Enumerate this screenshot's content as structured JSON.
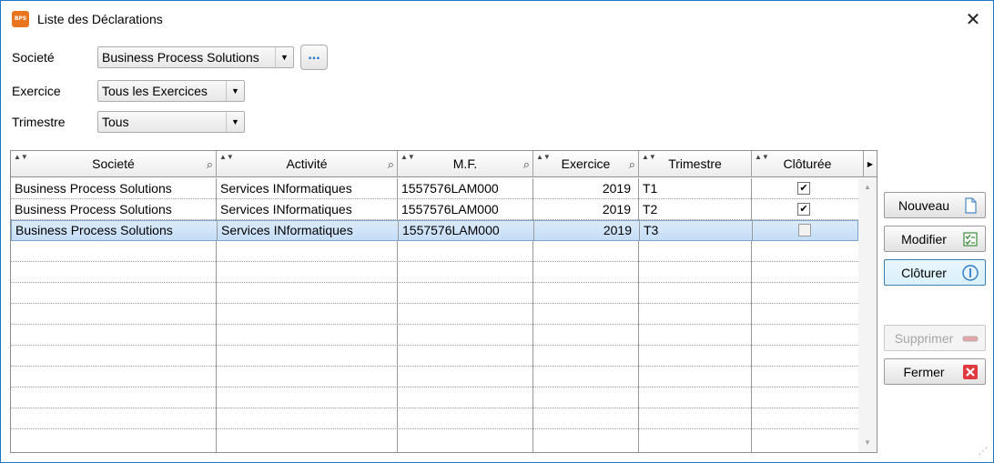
{
  "window": {
    "icon_label": "BPS",
    "title": "Liste des Déclarations",
    "close_glyph": "✕"
  },
  "filters": {
    "societe_label": "Societé",
    "societe_value": "Business Process Solutions",
    "ellipsis_label": "...",
    "exercice_label": "Exercice",
    "exercice_value": "Tous les Exercices",
    "trimestre_label": "Trimestre",
    "trimestre_value": "Tous"
  },
  "grid": {
    "columns": [
      "Societé",
      "Activité",
      "M.F.",
      "Exercice",
      "Trimestre",
      "Clôturée"
    ],
    "rows": [
      {
        "societe": "Business Process Solutions",
        "activite": "Services INformatiques",
        "mf": "1557576LAM000",
        "exercice": "2019",
        "trimestre": "T1",
        "cloturee": true
      },
      {
        "societe": "Business Process Solutions",
        "activite": "Services INformatiques",
        "mf": "1557576LAM000",
        "exercice": "2019",
        "trimestre": "T2",
        "cloturee": true
      },
      {
        "societe": "Business Process Solutions",
        "activite": "Services INformatiques",
        "mf": "1557576LAM000",
        "exercice": "2019",
        "trimestre": "T3",
        "cloturee": false
      }
    ],
    "selected_row": 2
  },
  "buttons": {
    "nouveau": "Nouveau",
    "modifier": "Modifier",
    "cloturer": "Clôturer",
    "supprimer": "Supprimer",
    "fermer": "Fermer"
  },
  "icons": {
    "nouveau": "new-document-icon",
    "modifier": "edit-checklist-icon",
    "cloturer": "info-circle-icon",
    "supprimer": "remove-bar-icon",
    "fermer": "close-red-icon"
  },
  "colors": {
    "accent": "#1b76c8",
    "selection": "#c4ddf6",
    "danger": "#e0393e"
  }
}
